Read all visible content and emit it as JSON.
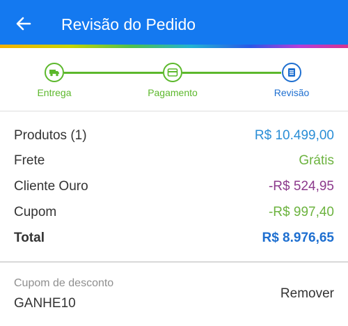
{
  "header": {
    "title": "Revisão do Pedido",
    "back_icon": "arrow-left-icon",
    "background": "#1479f0"
  },
  "stepper": {
    "steps": [
      {
        "label": "Entrega",
        "icon": "truck-icon",
        "state": "done"
      },
      {
        "label": "Pagamento",
        "icon": "credit-card-icon",
        "state": "done"
      },
      {
        "label": "Revisão",
        "icon": "document-icon",
        "state": "active"
      }
    ],
    "colors": {
      "done": "#5cb82c",
      "active": "#1e6fd0"
    }
  },
  "summary": {
    "products": {
      "label": "Produtos (1)",
      "value": "R$ 10.499,00",
      "color": "#2a8ed6"
    },
    "shipping": {
      "label": "Frete",
      "value": "Grátis",
      "color": "#6cb33f"
    },
    "gold_client": {
      "label": "Cliente Ouro",
      "value": "-R$ 524,95",
      "color": "#8c3a8c"
    },
    "coupon": {
      "label": "Cupom",
      "value": "-R$ 997,40",
      "color": "#6cb33f"
    },
    "total": {
      "label": "Total",
      "value": "R$ 8.976,65",
      "color": "#1e6fd0"
    }
  },
  "discount": {
    "title": "Cupom de desconto",
    "code": "GANHE10",
    "remove_label": "Remover"
  }
}
